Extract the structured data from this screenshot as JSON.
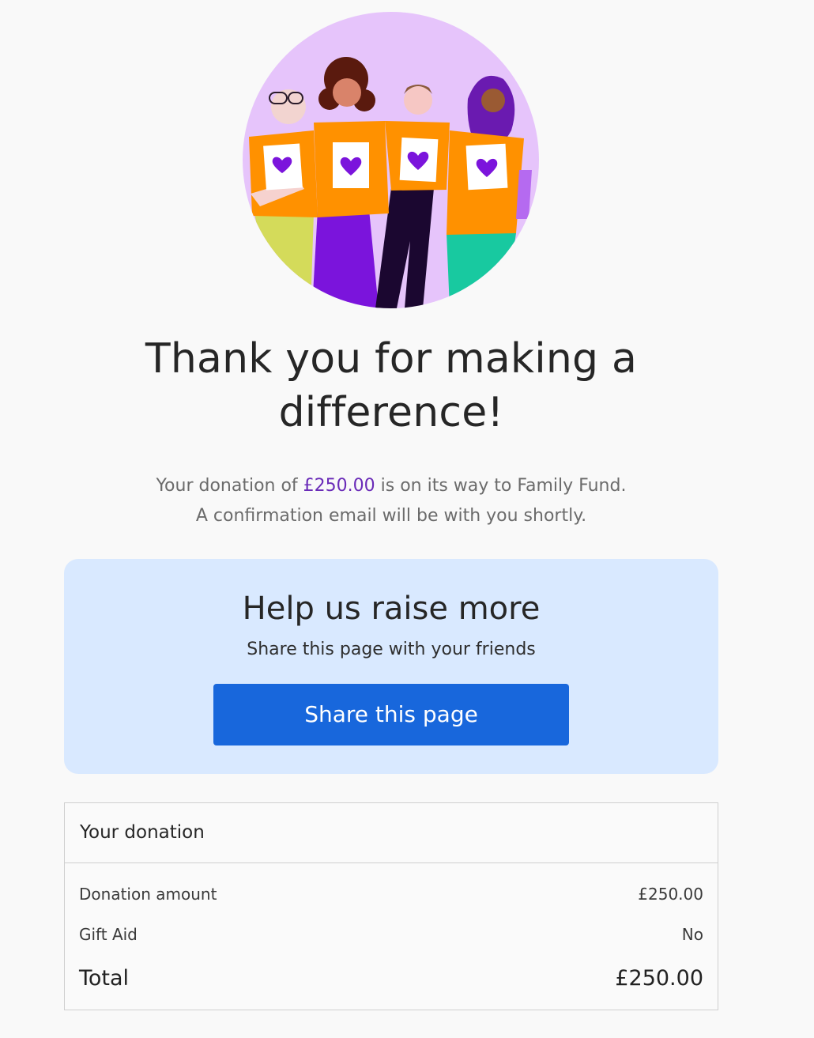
{
  "hero": {
    "illustration": "four-people-with-heart-shirts-illustration",
    "background_color": "#e6c4fb",
    "accent_color": "#7b14dc",
    "shirt_color": "#ff9100"
  },
  "confirmation": {
    "title": "Thank you for making a difference!",
    "message_prefix": "Your donation of ",
    "amount": "£250.00",
    "message_suffix": " is on its way to Family Fund.",
    "email_note": "A confirmation email will be with you shortly."
  },
  "share": {
    "title": "Help us raise more",
    "subtitle": "Share this page with your friends",
    "button_label": "Share this page",
    "button_color": "#1867dc",
    "card_color": "#d9e9ff"
  },
  "summary": {
    "title": "Your donation",
    "rows": [
      {
        "label": "Donation amount",
        "value": "£250.00"
      },
      {
        "label": "Gift Aid",
        "value": "No"
      }
    ],
    "total": {
      "label": "Total",
      "value": "£250.00"
    }
  }
}
